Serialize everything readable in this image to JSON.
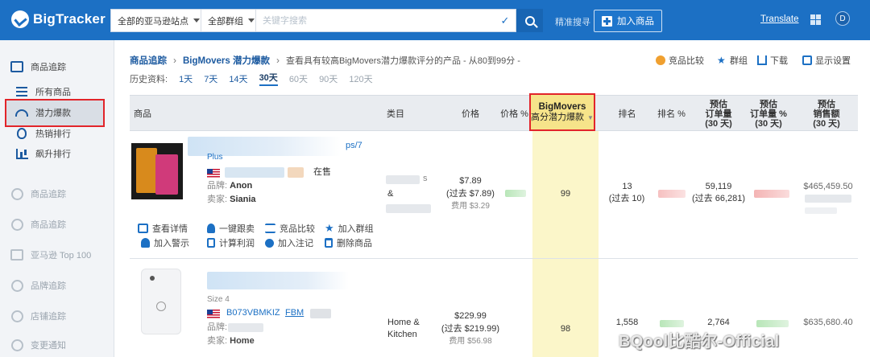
{
  "brand": {
    "name": "BigTracker"
  },
  "search": {
    "marketplace": "全部的亚马逊站点",
    "group": "全部群组",
    "placeholder": "关键字搜索",
    "exact_label": "精准搜寻",
    "add_button": "加入商品"
  },
  "header": {
    "translate": "Translate",
    "avatar_initial": "D"
  },
  "sidebar": {
    "items": [
      {
        "label": "商品追踪",
        "icon": "monitor-icon"
      },
      {
        "label": "所有商品",
        "icon": "list-icon"
      },
      {
        "label": "潜力爆款",
        "icon": "gauge-icon"
      },
      {
        "label": "热销排行",
        "icon": "fire-icon"
      },
      {
        "label": "飙升排行",
        "icon": "bar-chart-icon"
      },
      {
        "label": "商品追踪",
        "icon": "circle-icon"
      },
      {
        "label": "商品追踪",
        "icon": "circle-icon"
      },
      {
        "label": "亚马逊 Top 100",
        "icon": "building-icon"
      },
      {
        "label": "品牌追踪",
        "icon": "compass-icon"
      },
      {
        "label": "店铺追踪",
        "icon": "store-icon"
      },
      {
        "label": "变更通知",
        "icon": "bell-icon"
      }
    ]
  },
  "breadcrumb": {
    "root": "商品追踪",
    "current": "BigMovers 潜力爆款",
    "description": "查看具有较高BigMovers潜力爆款评分的产品 - 从80到99分 -"
  },
  "toolbar": {
    "compare": "竞品比较",
    "group": "群组",
    "download": "下载",
    "display": "显示设置"
  },
  "history": {
    "label": "历史资料:",
    "options": [
      "1天",
      "7天",
      "14天",
      "30天",
      "60天",
      "90天",
      "120天"
    ],
    "active": "30天"
  },
  "columns": {
    "product": "商品",
    "category": "类目",
    "price": "价格",
    "price_pct": "价格 %",
    "bigmovers_title": "BigMovers",
    "bigmovers_sub": "高分潜力爆款",
    "rank": "排名",
    "rank_pct": "排名 %",
    "est_orders": [
      "预估",
      "订单量",
      "(30 天)"
    ],
    "est_orders_pct": [
      "预估",
      "订单量 %",
      "(30 天)"
    ],
    "est_sales": [
      "预估",
      "销售额",
      "(30 天)"
    ]
  },
  "rows": [
    {
      "title_fragment": "ps/7",
      "title_fragment2": "Plus",
      "status": "在售",
      "brand_label": "品牌:",
      "brand_value": "Anon",
      "seller_label": "卖家:",
      "seller_value": "Siania",
      "category_fragment": "s",
      "category_symbol": "&",
      "price": "$7.89",
      "price_before": "(过去 $7.89)",
      "price_fee": "费用 $3.29",
      "bigmovers_score": "99",
      "rank": "13",
      "rank_before": "(过去 10)",
      "orders": "59,119",
      "orders_before": "(过去 66,281)",
      "sales": "$465,459.50"
    },
    {
      "size": "Size 4",
      "asin": "B073VBMKIZ",
      "fulfillment": "FBM",
      "brand_label": "品牌:",
      "seller_label": "卖家:",
      "seller_value": "Home",
      "category": "Home & Kitchen",
      "price": "$229.99",
      "price_before": "(过去 $219.99)",
      "price_fee": "费用 $56.98",
      "bigmovers_score": "98",
      "rank": "1,558",
      "orders": "2,764",
      "sales": "$635,680.40"
    }
  ],
  "actions": {
    "details": "查看详情",
    "follow": "一键跟卖",
    "compare": "竞品比较",
    "add_group": "加入群组",
    "alert": "加入警示",
    "profit": "计算利润",
    "note": "加入注记",
    "delete": "删除商品"
  },
  "watermark": "BQool比酷尔-Official",
  "colors": {
    "topbar": "#1c70c4",
    "highlight_border": "#e2242a",
    "bigmovers_bg": "#fbf6c9"
  }
}
